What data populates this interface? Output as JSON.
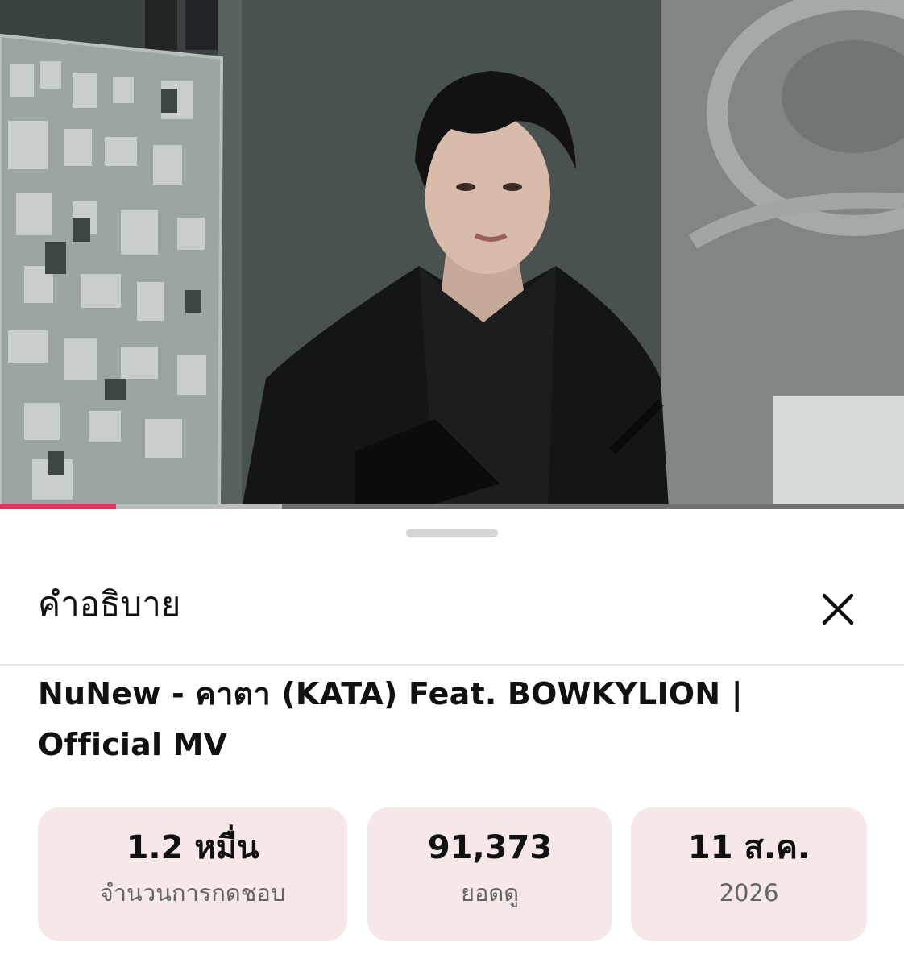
{
  "video": {
    "progress_played": 0.128,
    "progress_buffered": 0.312
  },
  "sheet": {
    "title": "คำอธิบาย",
    "close_icon": "close-icon"
  },
  "description": {
    "video_title": "NuNew - คาตา (KATA) Feat. BOWKYLION | Official MV"
  },
  "stats": {
    "likes_value": "1.2 หมื่น",
    "likes_label": "จำนวนการกดชอบ",
    "views_value": "91,373",
    "views_label": "ยอดดู",
    "date_value": "11 ส.ค.",
    "date_year": "2026"
  },
  "colors": {
    "progress_played": "#f1305d",
    "stat_background": "#f6e8e8"
  }
}
